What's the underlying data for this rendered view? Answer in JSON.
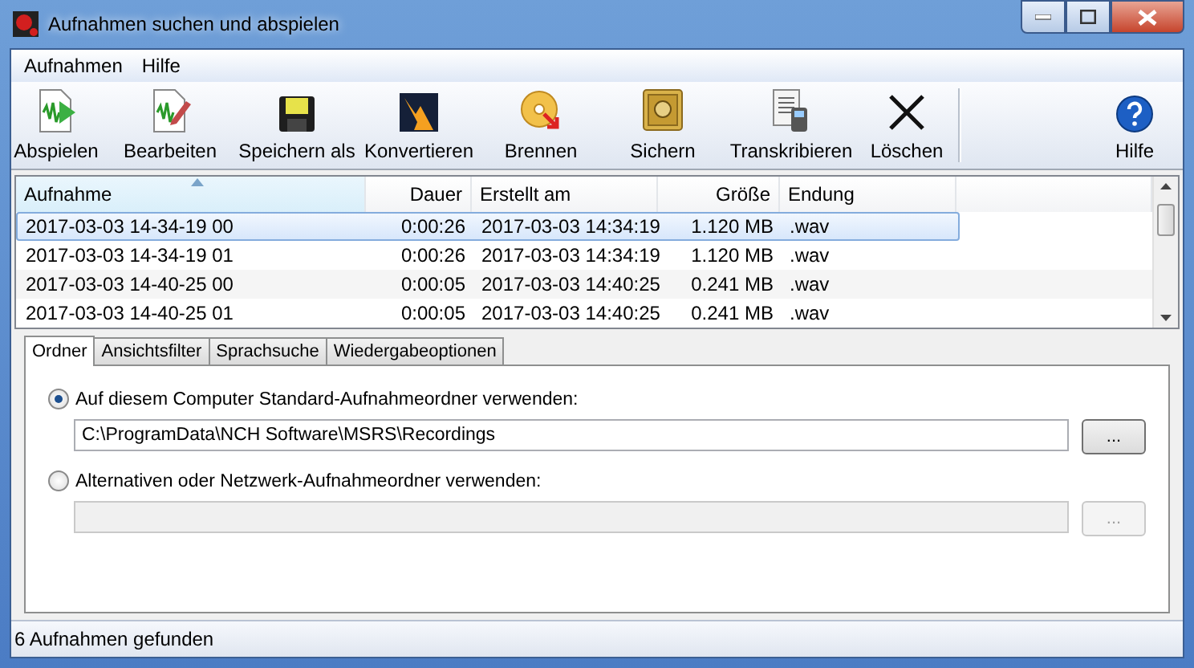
{
  "window": {
    "title": "Aufnahmen suchen und abspielen"
  },
  "menu": [
    "Aufnahmen",
    "Hilfe"
  ],
  "toolbar": [
    {
      "label": "Abspielen"
    },
    {
      "label": "Bearbeiten"
    },
    {
      "label": "Speichern als"
    },
    {
      "label": "Konvertieren"
    },
    {
      "label": "Brennen"
    },
    {
      "label": "Sichern"
    },
    {
      "label": "Transkribieren"
    },
    {
      "label": "Löschen"
    }
  ],
  "help_button": {
    "label": "Hilfe"
  },
  "table": {
    "columns": [
      {
        "label": "Aufnahme",
        "sorted": true
      },
      {
        "label": "Dauer",
        "sorted": false
      },
      {
        "label": "Erstellt am",
        "sorted": false
      },
      {
        "label": "Größe",
        "sorted": false
      },
      {
        "label": "Endung",
        "sorted": false
      }
    ],
    "rows": [
      {
        "cells": [
          "2017-03-03 14-34-19 00",
          "0:00:26",
          "2017-03-03 14:34:19",
          "1.120 MB",
          ".wav"
        ],
        "selected": true
      },
      {
        "cells": [
          "2017-03-03 14-34-19 01",
          "0:00:26",
          "2017-03-03 14:34:19",
          "1.120 MB",
          ".wav"
        ],
        "selected": false
      },
      {
        "cells": [
          "2017-03-03 14-40-25 00",
          "0:00:05",
          "2017-03-03 14:40:25",
          "0.241 MB",
          ".wav"
        ],
        "selected": false
      },
      {
        "cells": [
          "2017-03-03 14-40-25 01",
          "0:00:05",
          "2017-03-03 14:40:25",
          "0.241 MB",
          ".wav"
        ],
        "selected": false
      }
    ]
  },
  "tabs": [
    {
      "label": "Ordner",
      "selected": true
    },
    {
      "label": "Ansichtsfilter",
      "selected": false
    },
    {
      "label": "Sprachsuche",
      "selected": false
    },
    {
      "label": "Wiedergabeoptionen",
      "selected": false
    }
  ],
  "folder_options": [
    {
      "label": "Auf diesem Computer Standard-Aufnahmeordner verwenden:",
      "selected": true,
      "path": "C:\\ProgramData\\NCH Software\\MSRS\\Recordings",
      "disabled": false,
      "browse": "..."
    },
    {
      "label": "Alternativen oder Netzwerk-Aufnahmeordner verwenden:",
      "selected": false,
      "disabled": true,
      "browse": "..."
    }
  ],
  "status_bar": "6 Aufnahmen gefunden"
}
